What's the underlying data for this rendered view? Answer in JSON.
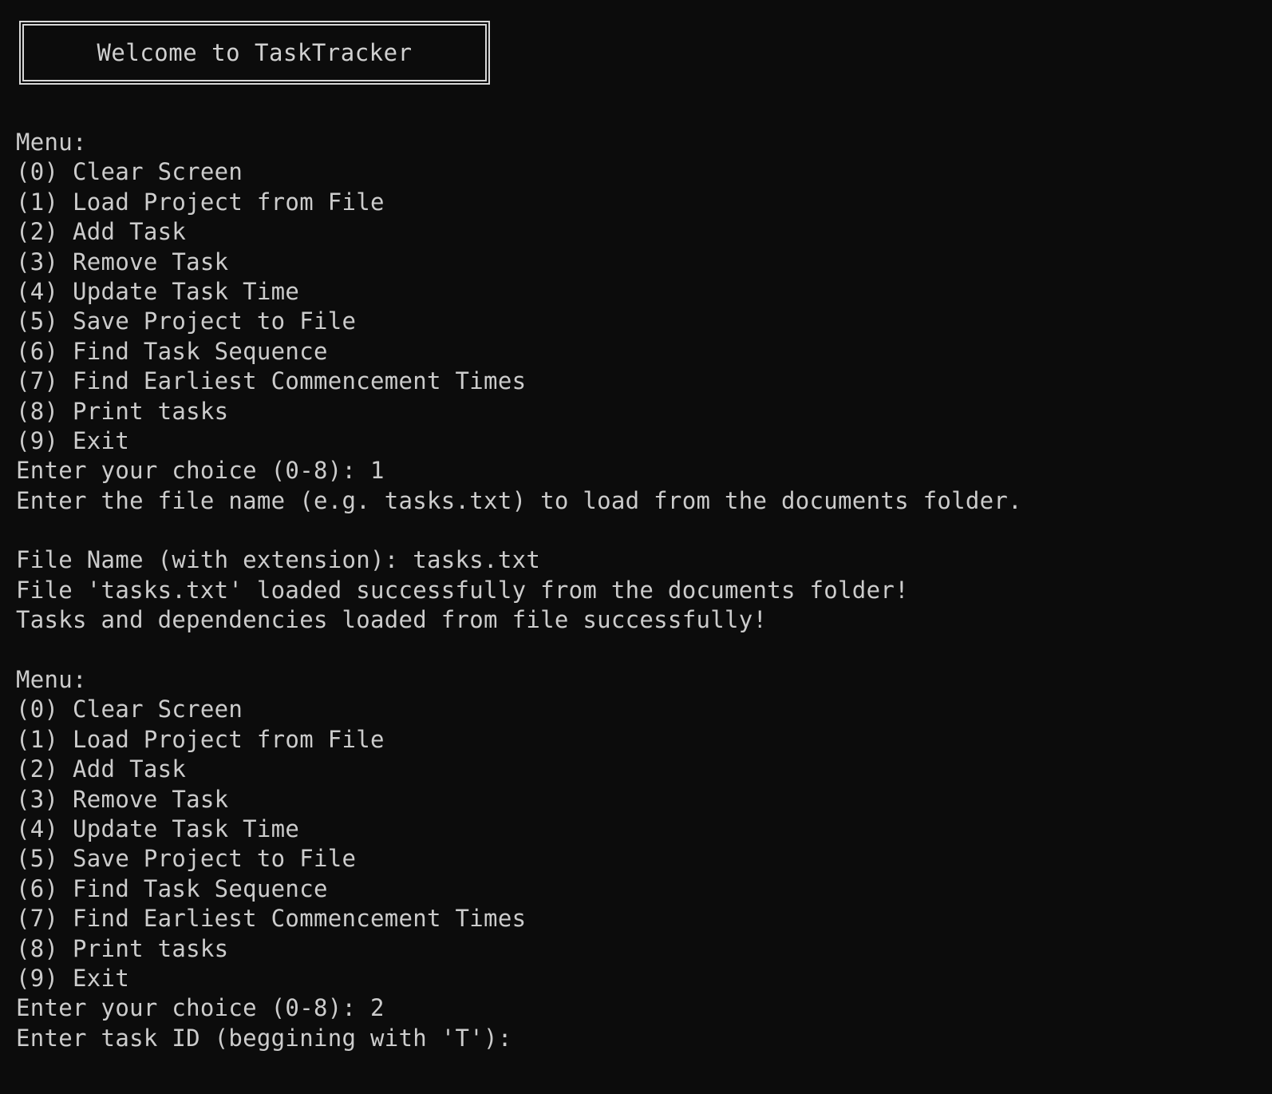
{
  "banner": {
    "title": "Welcome to TaskTracker"
  },
  "lines": [
    "Menu:",
    "(0) Clear Screen",
    "(1) Load Project from File",
    "(2) Add Task",
    "(3) Remove Task",
    "(4) Update Task Time",
    "(5) Save Project to File",
    "(6) Find Task Sequence",
    "(7) Find Earliest Commencement Times",
    "(8) Print tasks",
    "(9) Exit",
    "Enter your choice (0-8): 1",
    "Enter the file name (e.g. tasks.txt) to load from the documents folder.",
    "",
    "File Name (with extension): tasks.txt",
    "File 'tasks.txt' loaded successfully from the documents folder!",
    "Tasks and dependencies loaded from file successfully!",
    "",
    "Menu:",
    "(0) Clear Screen",
    "(1) Load Project from File",
    "(2) Add Task",
    "(3) Remove Task",
    "(4) Update Task Time",
    "(5) Save Project to File",
    "(6) Find Task Sequence",
    "(7) Find Earliest Commencement Times",
    "(8) Print tasks",
    "(9) Exit",
    "Enter your choice (0-8): 2"
  ],
  "prompt": {
    "label": "Enter task ID (beggining with 'T'):",
    "value": ""
  }
}
